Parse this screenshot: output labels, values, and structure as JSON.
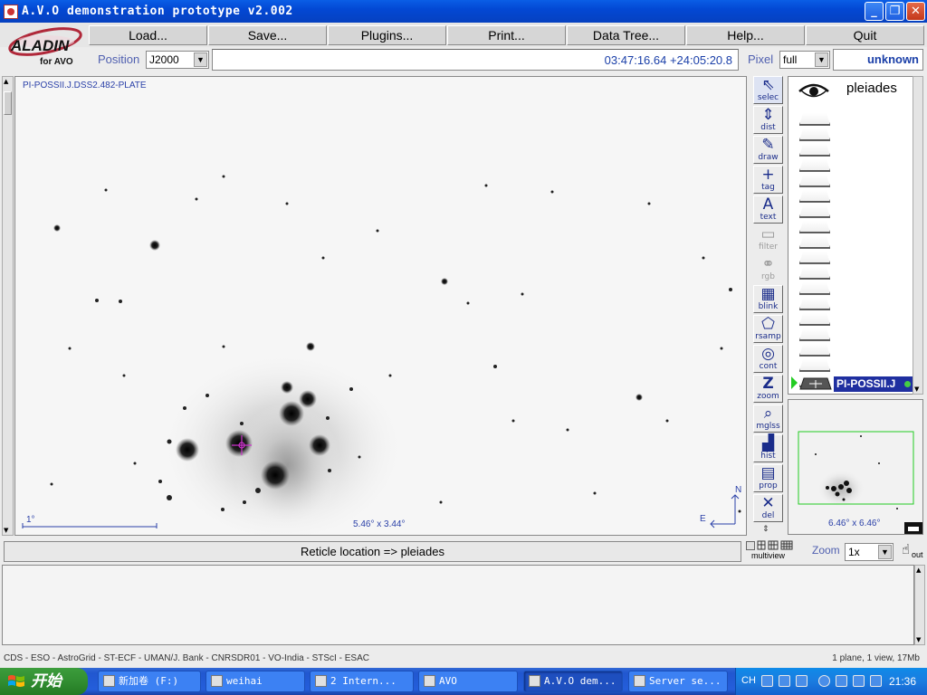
{
  "window": {
    "title": "A.V.O demonstration prototype v2.002"
  },
  "logo": {
    "text": "ALADIN",
    "subtext": "for AVO"
  },
  "menu": [
    "Load...",
    "Save...",
    "Plugins...",
    "Print...",
    "Data Tree...",
    "Help...",
    "Quit"
  ],
  "position": {
    "label": "Position",
    "frame": "J2000",
    "coord": "03:47:16.64 +24:05:20.8"
  },
  "pixel": {
    "label": "Pixel",
    "mode": "full",
    "value": "unknown"
  },
  "image": {
    "survey_label": "PI-POSSII.J.DSS2.482-PLATE",
    "scale_label": "1°",
    "fov": "5.46° x 3.44°",
    "north": "N",
    "east": "E"
  },
  "tools": [
    {
      "name": "select",
      "label": "selec",
      "enabled": true
    },
    {
      "name": "dist",
      "label": "dist",
      "enabled": true
    },
    {
      "name": "draw",
      "label": "draw",
      "enabled": true
    },
    {
      "name": "tag",
      "label": "tag",
      "enabled": true
    },
    {
      "name": "text",
      "label": "text",
      "enabled": true
    },
    {
      "name": "filter",
      "label": "filter",
      "enabled": false
    },
    {
      "name": "rgb",
      "label": "rgb",
      "enabled": false
    },
    {
      "name": "blink",
      "label": "blink",
      "enabled": true
    },
    {
      "name": "rsamp",
      "label": "rsamp",
      "enabled": true
    },
    {
      "name": "cont",
      "label": "cont",
      "enabled": true
    },
    {
      "name": "zoom",
      "label": "zoom",
      "enabled": true
    },
    {
      "name": "mglss",
      "label": "mglss",
      "enabled": true
    },
    {
      "name": "hist",
      "label": "hist",
      "enabled": true
    },
    {
      "name": "prop",
      "label": "prop",
      "enabled": true
    },
    {
      "name": "del",
      "label": "del",
      "enabled": true
    }
  ],
  "stack": {
    "object": "pleiades",
    "plane": "PI-POSSII.J",
    "empty_slots": 18
  },
  "overview": {
    "fov": "6.46° x 6.46°"
  },
  "status": {
    "reticle": "Reticle location => pleiades",
    "multiview": "multiview",
    "zoom_label": "Zoom",
    "zoom_value": "1x",
    "out": "out"
  },
  "footer": {
    "credits": "CDS - ESO - AstroGrid - ST-ECF - UMAN/J. Bank - CNRSDR01 - VO-India - STScI - ESAC",
    "info": "1 plane, 1 view, 17Mb"
  },
  "taskbar": {
    "start": "开始",
    "tasks": [
      {
        "label": "新加卷 (F:)",
        "active": false
      },
      {
        "label": "weihai",
        "active": false
      },
      {
        "label": "2 Intern...",
        "active": false
      },
      {
        "label": "AVO",
        "active": false
      },
      {
        "label": "A.V.O dem...",
        "active": true
      },
      {
        "label": "Server se...",
        "active": false
      }
    ],
    "lang": "CH",
    "clock": "21:36"
  },
  "colors": {
    "title_blue": "#0348d4",
    "plane_selected": "#1f2fa0",
    "coord_text": "#1a3fa8",
    "reticle": "#cc33cc",
    "start_green": "#2f8a2f"
  }
}
